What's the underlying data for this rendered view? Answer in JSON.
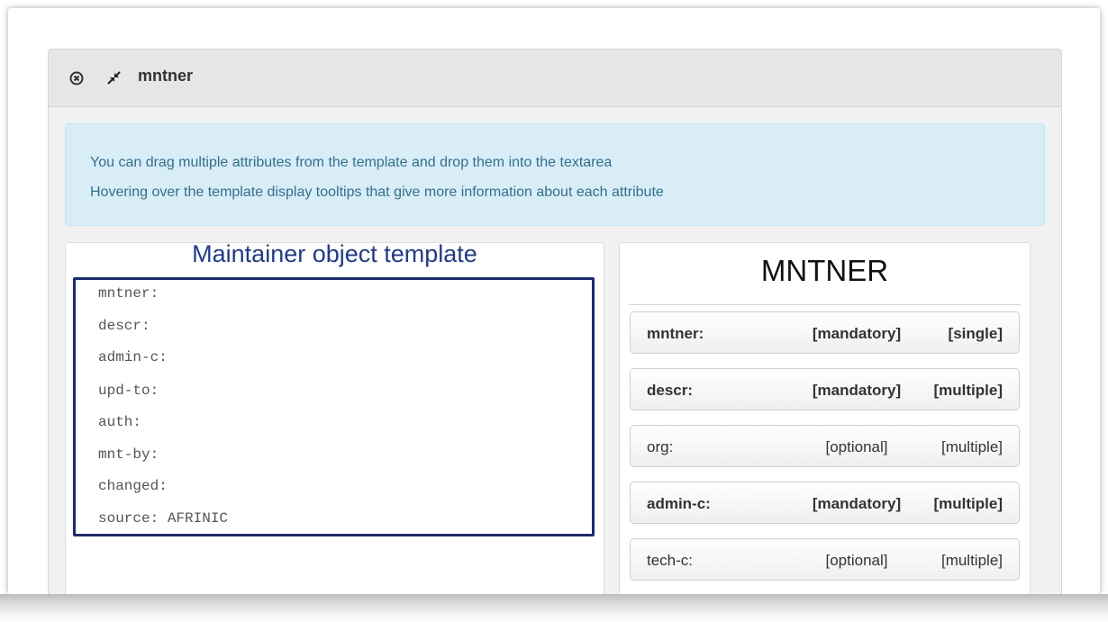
{
  "panel": {
    "title": "mntner",
    "close_icon": "circle-x-icon",
    "collapse_icon": "compress-arrows-icon"
  },
  "alert": {
    "line1": "You can drag multiple attributes from the template and drop them into the textarea",
    "line2": "Hovering over the template display tooltips that give more information about each attribute"
  },
  "template": {
    "heading": "Maintainer object template",
    "lines": [
      "mntner:",
      "descr:",
      "admin-c:",
      "upd-to:",
      "auth:",
      "mnt-by:",
      "changed:",
      "source: AFRINIC"
    ]
  },
  "mntner": {
    "title": "MNTNER",
    "attributes": [
      {
        "name": "mntner:",
        "requirement": "[mandatory]",
        "cardinality": "[single]",
        "mandatory": true
      },
      {
        "name": "descr:",
        "requirement": "[mandatory]",
        "cardinality": "[multiple]",
        "mandatory": true
      },
      {
        "name": "org:",
        "requirement": "[optional]",
        "cardinality": "[multiple]",
        "mandatory": false
      },
      {
        "name": "admin-c:",
        "requirement": "[mandatory]",
        "cardinality": "[multiple]",
        "mandatory": true
      },
      {
        "name": "tech-c:",
        "requirement": "[optional]",
        "cardinality": "[multiple]",
        "mandatory": false
      }
    ]
  },
  "colors": {
    "alert_bg": "#d9edf7",
    "alert_text": "#31708f",
    "template_heading": "#1f3a93",
    "template_border": "#1a2a7a"
  }
}
